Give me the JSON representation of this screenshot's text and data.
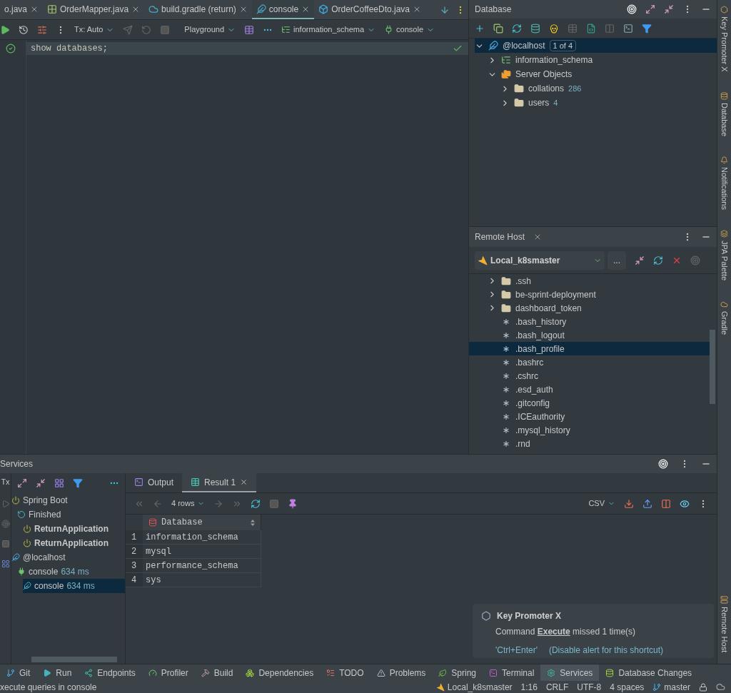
{
  "editor_tabs": [
    {
      "label": "o.java",
      "kind": "java",
      "selected": false
    },
    {
      "label": "OrderMapper.java",
      "kind": "mapper",
      "selected": false
    },
    {
      "label": "build.gradle (return)",
      "kind": "gradle",
      "selected": false
    },
    {
      "label": "console",
      "kind": "console",
      "selected": true
    },
    {
      "label": "OrderCoffeeDto.java",
      "kind": "dto",
      "selected": false
    }
  ],
  "editor_toolbar": {
    "tx": "Tx: Auto",
    "playground": "Playground",
    "schema": "information_schema",
    "session": "console"
  },
  "editor": {
    "lines": [
      {
        "code": "show databases;",
        "selected": true
      }
    ]
  },
  "database_panel": {
    "title": "Database",
    "tree": [
      {
        "label": "@localhost",
        "badge": "1 of 4",
        "kind": "host",
        "expanded": true,
        "selected": true,
        "children": [
          {
            "label": "information_schema",
            "kind": "schema",
            "expanded": false,
            "selected": false
          },
          {
            "label": "Server Objects",
            "kind": "group",
            "expanded": true,
            "selected": false,
            "children": [
              {
                "label": "collations",
                "count": "286",
                "kind": "folder",
                "expanded": false,
                "selected": false
              },
              {
                "label": "users",
                "count": "4",
                "kind": "folder",
                "expanded": false,
                "selected": false
              }
            ]
          }
        ]
      }
    ]
  },
  "remote_host": {
    "title": "Remote Host",
    "connection": "Local_k8smaster",
    "more_button": "...",
    "files": [
      {
        "name": ".ssh",
        "kind": "folder",
        "selected": false
      },
      {
        "name": "be-sprint-deployment",
        "kind": "folder",
        "selected": false
      },
      {
        "name": "dashboard_token",
        "kind": "folder",
        "selected": false
      },
      {
        "name": ".bash_history",
        "kind": "file",
        "selected": false
      },
      {
        "name": ".bash_logout",
        "kind": "file",
        "selected": false
      },
      {
        "name": ".bash_profile",
        "kind": "file",
        "selected": true
      },
      {
        "name": ".bashrc",
        "kind": "file",
        "selected": false
      },
      {
        "name": ".cshrc",
        "kind": "file",
        "selected": false
      },
      {
        "name": ".esd_auth",
        "kind": "file",
        "selected": false
      },
      {
        "name": ".gitconfig",
        "kind": "file",
        "selected": false
      },
      {
        "name": ".ICEauthority",
        "kind": "file",
        "selected": false
      },
      {
        "name": ".mysql_history",
        "kind": "file",
        "selected": false
      },
      {
        "name": ".rnd",
        "kind": "file",
        "selected": false
      }
    ]
  },
  "services": {
    "title": "Services",
    "tx_label": "Tx",
    "tree": [
      {
        "label": "Spring Boot",
        "kind": "spring",
        "selected": false,
        "children": [
          {
            "label": "Finished",
            "kind": "finished",
            "selected": false,
            "children": [
              {
                "label": "ReturnApplication",
                "kind": "app",
                "selected": false
              },
              {
                "label": "ReturnApplication",
                "kind": "app",
                "selected": false
              }
            ]
          }
        ]
      },
      {
        "label": "@localhost",
        "kind": "host",
        "selected": false,
        "children": [
          {
            "label": "console",
            "time": "634 ms",
            "kind": "session",
            "selected": false,
            "children": [
              {
                "label": "console",
                "time": "634 ms",
                "kind": "console",
                "selected": true
              }
            ]
          }
        ]
      }
    ]
  },
  "result": {
    "tabs": [
      {
        "label": "Output",
        "kind": "output",
        "selected": false
      },
      {
        "label": "Result 1",
        "kind": "table",
        "selected": true
      }
    ],
    "rows_label": "4 rows",
    "format": "CSV",
    "column": "Database",
    "rows": [
      {
        "number": "1",
        "value": "information_schema"
      },
      {
        "number": "2",
        "value": "mysql"
      },
      {
        "number": "3",
        "value": "performance_schema"
      },
      {
        "number": "4",
        "value": "sys"
      }
    ]
  },
  "notification": {
    "title": "Key Promoter X",
    "before": "Command",
    "link": "Execute",
    "after": "missed 1 time(s)",
    "shortcut": "'Ctrl+Enter'",
    "action": "(Disable alert for this shortcut)"
  },
  "side_stripe": {
    "top": [
      {
        "label": "Key Promoter X",
        "kind": "keypromoter"
      },
      {
        "label": "Database",
        "kind": "database"
      },
      {
        "label": "Notifications",
        "kind": "bell"
      },
      {
        "label": "JPA Palette",
        "kind": "jpa"
      },
      {
        "label": "Gradle",
        "kind": "gradle"
      }
    ],
    "bottom": [
      {
        "label": "Remote Host",
        "kind": "remote"
      }
    ]
  },
  "tool_bar": [
    {
      "label": "Git",
      "kind": "git",
      "selected": false
    },
    {
      "label": "Run",
      "kind": "run",
      "selected": false
    },
    {
      "label": "Endpoints",
      "kind": "endpoints",
      "selected": false
    },
    {
      "label": "Profiler",
      "kind": "profiler",
      "selected": false
    },
    {
      "label": "Build",
      "kind": "build",
      "selected": false
    },
    {
      "label": "Dependencies",
      "kind": "deps",
      "selected": false
    },
    {
      "label": "TODO",
      "kind": "todo",
      "selected": false
    },
    {
      "label": "Problems",
      "kind": "problems",
      "selected": false
    },
    {
      "label": "Spring",
      "kind": "spring",
      "selected": false
    },
    {
      "label": "Terminal",
      "kind": "terminal",
      "selected": false
    },
    {
      "label": "Services",
      "kind": "services",
      "selected": true
    },
    {
      "label": "Database Changes",
      "kind": "dbchanges",
      "selected": false
    }
  ],
  "status_bar": {
    "message": "xecute queries in console",
    "connection": "Local_k8smaster",
    "position": "1:16",
    "line_separator": "CRLF",
    "encoding": "UTF-8",
    "indent": "4 spaces",
    "branch": "master"
  }
}
